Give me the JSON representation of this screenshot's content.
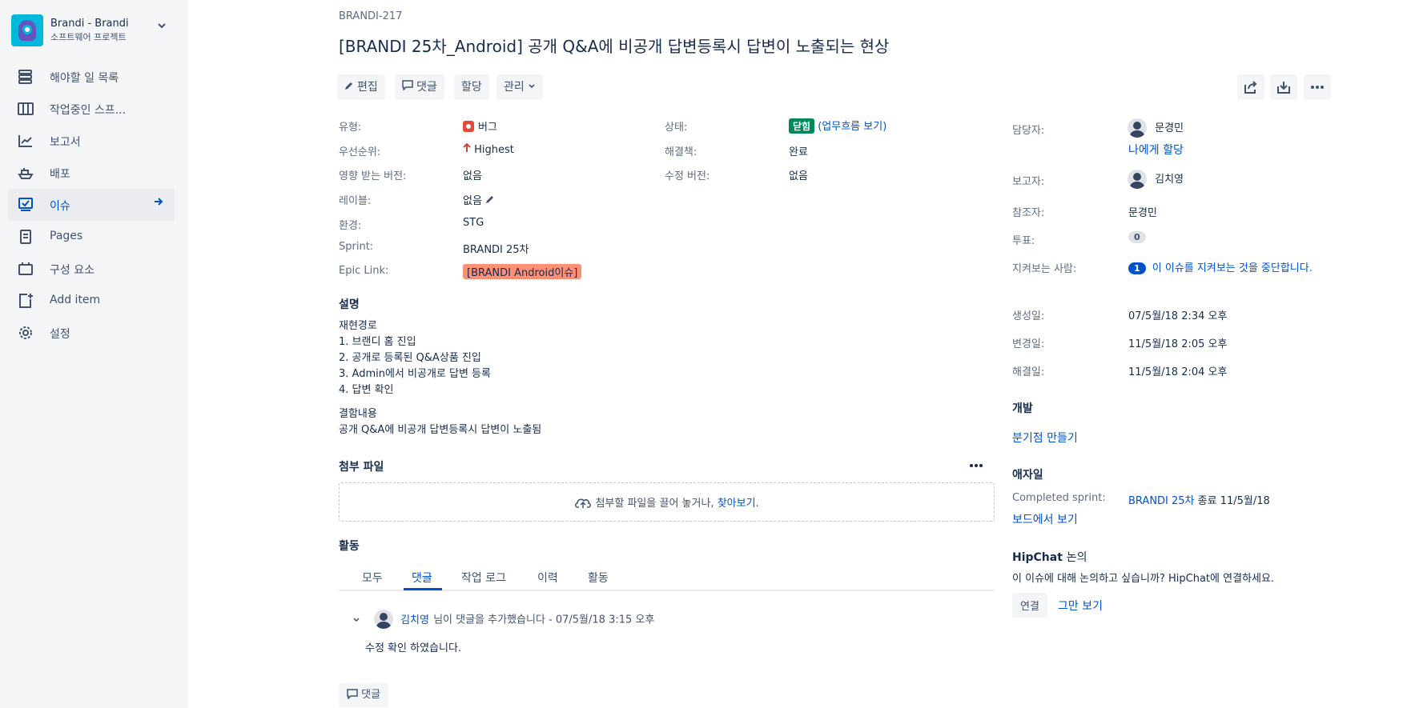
{
  "project": {
    "name": "Brandi - Brandi",
    "type": "소프트웨어 프로젝트"
  },
  "sidebar": {
    "items": [
      {
        "label": "해야할 일 목록",
        "icon": "backlog-icon"
      },
      {
        "label": "작업중인 스프...",
        "icon": "board-icon"
      },
      {
        "label": "보고서",
        "icon": "reports-icon"
      },
      {
        "label": "배포",
        "icon": "releases-icon"
      },
      {
        "label": "이슈",
        "icon": "issues-icon",
        "active": true
      },
      {
        "label": "Pages",
        "icon": "pages-icon"
      },
      {
        "label": "구성 요소",
        "icon": "components-icon"
      },
      {
        "label": "Add item",
        "icon": "add-item-icon"
      },
      {
        "label": "설정",
        "icon": "settings-icon"
      }
    ]
  },
  "issue": {
    "key": "BRANDI-217",
    "summary": "[BRANDI 25차_Android] 공개 Q&A에 비공개 답변등록시 답변이 노출되는 현상"
  },
  "toolbar": {
    "edit": "편집",
    "comment": "댓글",
    "assign": "할당",
    "manage": "관리"
  },
  "details": {
    "type_label": "유형:",
    "type_value": "버그",
    "priority_label": "우선순위:",
    "priority_value": "Highest",
    "affects_label": "영향 받는 버전:",
    "affects_value": "없음",
    "labels_label": "레이블:",
    "labels_value": "없음",
    "env_label": "환경:",
    "env_value": "STG",
    "sprint_label": "Sprint:",
    "sprint_value": "BRANDI 25차",
    "epic_label": "Epic Link:",
    "epic_value": "[BRANDI Android이슈]",
    "status_label": "상태:",
    "status_value": "닫힘",
    "workflow_link": "(업무흐름 보기)",
    "resolution_label": "해결책:",
    "resolution_value": "완료",
    "fix_label": "수정 버전:",
    "fix_value": "없음"
  },
  "description": {
    "title": "설명",
    "lines": [
      "재현경로",
      "1. 브랜디 홈 진입",
      "2. 공개로 등록된 Q&A상품 진입",
      "3. Admin에서 비공개로 답변 등록",
      "4. 답변 확인"
    ],
    "defect_title": "결함내용",
    "defect_text": "공개 Q&A에 비공개 답변등록시 답변이 노출됨"
  },
  "attachments": {
    "title": "첨부 파일",
    "drop_text": "첨부할 파일을 끌어 놓거나,",
    "browse_link": "찾아보기."
  },
  "activity": {
    "title": "활동",
    "tabs": [
      "모두",
      "댓글",
      "작업 로그",
      "이력",
      "활동"
    ],
    "active_tab": 1,
    "comment_author": "김치영",
    "comment_meta": "님이 댓글을 추가했습니다 - 07/5월/18 3:15 오후",
    "comment_body": "수정 확인 하였습니다.",
    "comment_button": "댓글"
  },
  "people": {
    "assignee_label": "담당자:",
    "assignee": "문경민",
    "assign_me": "나에게 할당",
    "reporter_label": "보고자:",
    "reporter": "김치영",
    "participants_label": "참조자:",
    "participants": "문경민",
    "votes_label": "투표:",
    "votes": "0",
    "watchers_label": "지켜보는 사람:",
    "watchers": "1",
    "stop_watching": "이 이슈를 지켜보는 것을 중단합니다."
  },
  "dates": {
    "created_label": "생성일:",
    "created": "07/5월/18 2:34 오후",
    "updated_label": "변경일:",
    "updated": "11/5월/18 2:05 오후",
    "resolved_label": "해결일:",
    "resolved": "11/5월/18 2:04 오후"
  },
  "development": {
    "title": "개발",
    "create_branch": "분기점 만들기"
  },
  "agile": {
    "title": "애자일",
    "completed_label": "Completed sprint:",
    "sprint_link": "BRANDI 25차",
    "sprint_end": "종료 11/5월/18",
    "board_link": "보드에서 보기"
  },
  "hipchat": {
    "title_en": "HipChat",
    "title_ko": "논의",
    "text": "이 이슈에 대해 논의하고 싶습니까? HipChat에 연결하세요.",
    "connect": "연결",
    "dismiss": "그만 보기"
  },
  "colors": {
    "accent": "#0052cc",
    "sidebar_bg": "#f4f5f7",
    "status_done": "#00875a",
    "epic": "#ff8f73",
    "bug": "#e5493a",
    "priority": "#d04437"
  }
}
